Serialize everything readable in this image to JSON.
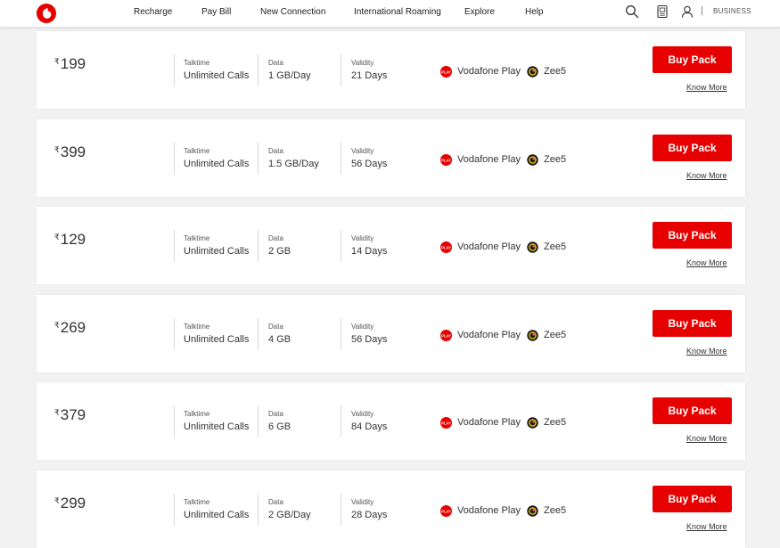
{
  "nav": {
    "links": [
      "Recharge",
      "Pay Bill",
      "New Connection",
      "International Roaming",
      "Explore",
      "Help"
    ],
    "business_label": "BUSINESS",
    "brand_color": "#e60000"
  },
  "labels": {
    "talktime": "Talktime",
    "data": "Data",
    "validity": "Validity",
    "currency": "₹",
    "buy": "Buy Pack",
    "know_more": "Know More"
  },
  "benefits": [
    {
      "name": "Vodafone Play",
      "icon": "vodafone-play-icon"
    },
    {
      "name": "Zee5",
      "icon": "zee5-icon"
    }
  ],
  "packs": [
    {
      "price": "199",
      "talktime": "Unlimited Calls",
      "data": "1 GB/Day",
      "validity": "21 Days"
    },
    {
      "price": "399",
      "talktime": "Unlimited Calls",
      "data": "1.5 GB/Day",
      "validity": "56 Days"
    },
    {
      "price": "129",
      "talktime": "Unlimited Calls",
      "data": "2 GB",
      "validity": "14 Days"
    },
    {
      "price": "269",
      "talktime": "Unlimited Calls",
      "data": "4 GB",
      "validity": "56 Days"
    },
    {
      "price": "379",
      "talktime": "Unlimited Calls",
      "data": "6 GB",
      "validity": "84 Days"
    },
    {
      "price": "299",
      "talktime": "Unlimited Calls",
      "data": "2 GB/Day",
      "validity": "28 Days"
    }
  ]
}
